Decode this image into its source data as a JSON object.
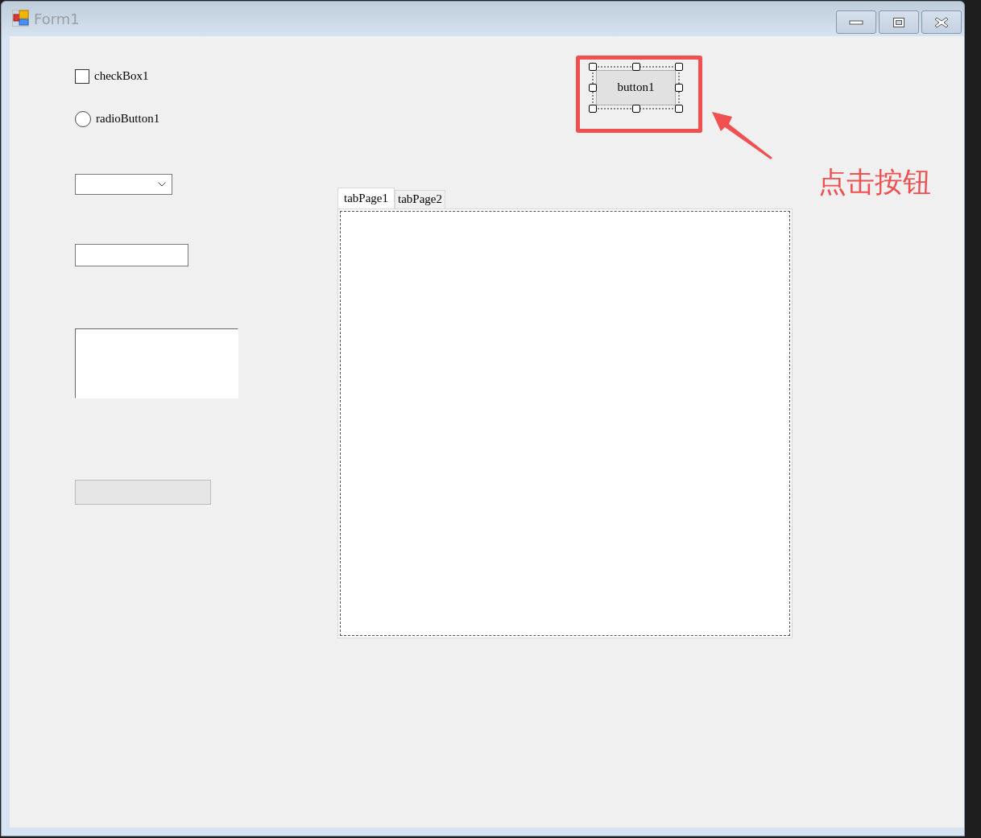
{
  "window": {
    "title": "Form1"
  },
  "checkbox": {
    "label": "checkBox1",
    "checked": false
  },
  "radio": {
    "label": "radioButton1",
    "selected": false
  },
  "button": {
    "label": "button1",
    "selected": true
  },
  "tabs": [
    {
      "label": "tabPage1",
      "selected": true
    },
    {
      "label": "tabPage2",
      "selected": false
    }
  ],
  "annotation": {
    "text": "点击按钮"
  }
}
